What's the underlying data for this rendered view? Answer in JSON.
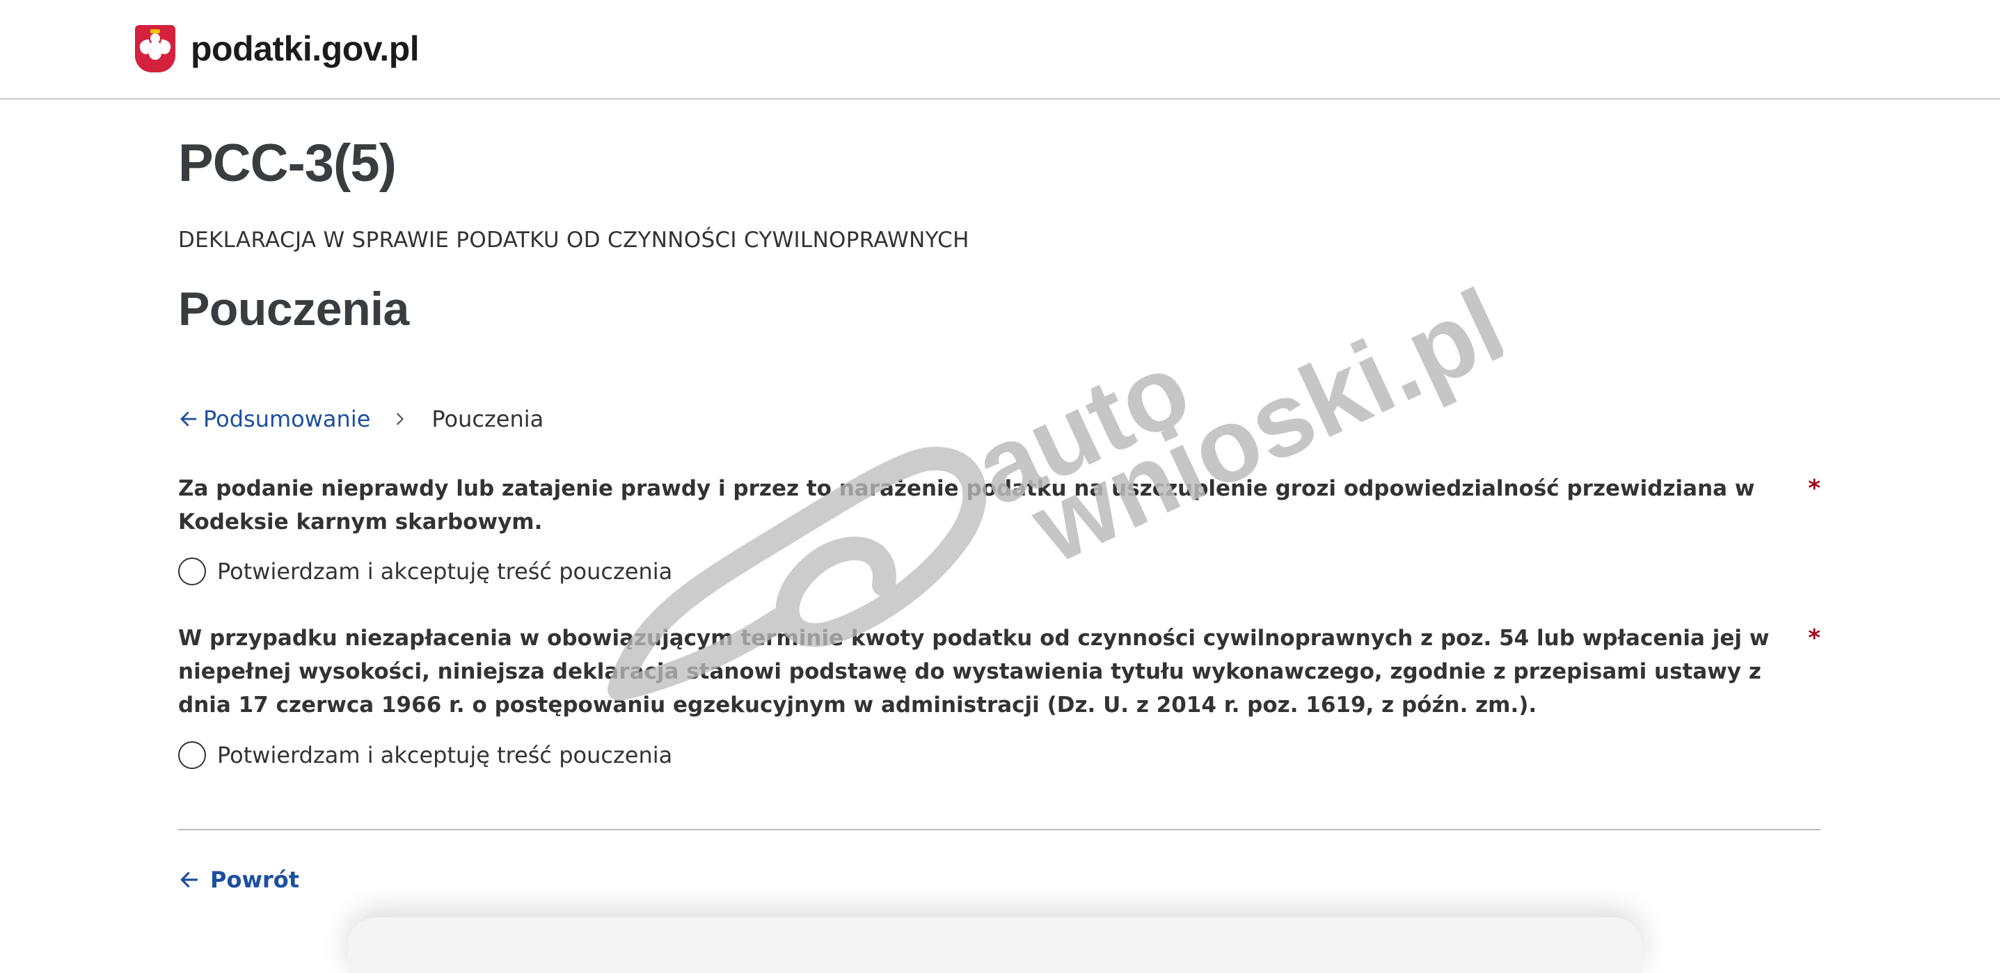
{
  "header": {
    "site_name": "podatki.gov.pl",
    "emblem_icon": "polish-eagle-emblem"
  },
  "page": {
    "form_code": "PCC-3(5)",
    "form_subtitle": "DEKLARACJA W SPRAWIE PODATKU OD CZYNNOŚCI CYWILNOPRAWNYCH",
    "section_title": "Pouczenia"
  },
  "breadcrumb": {
    "back_label": "Podsumowanie",
    "current_label": "Pouczenia"
  },
  "statements": [
    {
      "text": "Za podanie nieprawdy lub zatajenie prawdy i przez to narażenie podatku na uszczuplenie grozi odpowiedzialność przewidziana w Kodeksie karnym skarbowym.",
      "required_mark": "*",
      "radio_label": "Potwierdzam i akceptuję treść pouczenia",
      "checked": false
    },
    {
      "text": "W przypadku niezapłacenia w obowiązującym terminie kwoty podatku od czynności cywilnoprawnych z poz. 54 lub wpłacenia jej w niepełnej wysokości, niniejsza deklaracja stanowi podstawę do wystawienia tytułu wykonawczego, zgodnie z przepisami ustawy z dnia 17 czerwca 1966 r. o postępowaniu egzekucyjnym w administracji (Dz. U. z 2014 r. poz. 1619, z późn. zm.).",
      "required_mark": "*",
      "radio_label": "Potwierdzam i akceptuję treść pouczenia",
      "checked": false
    }
  ],
  "footer": {
    "back_button_label": "Powrót"
  },
  "watermark": {
    "line1": "auto",
    "line2": "wnioski.pl"
  },
  "colors": {
    "link": "#1c4fa0",
    "required": "#a0051a",
    "emblem_red": "#d4213d",
    "watermark": "#c2c2c2"
  }
}
